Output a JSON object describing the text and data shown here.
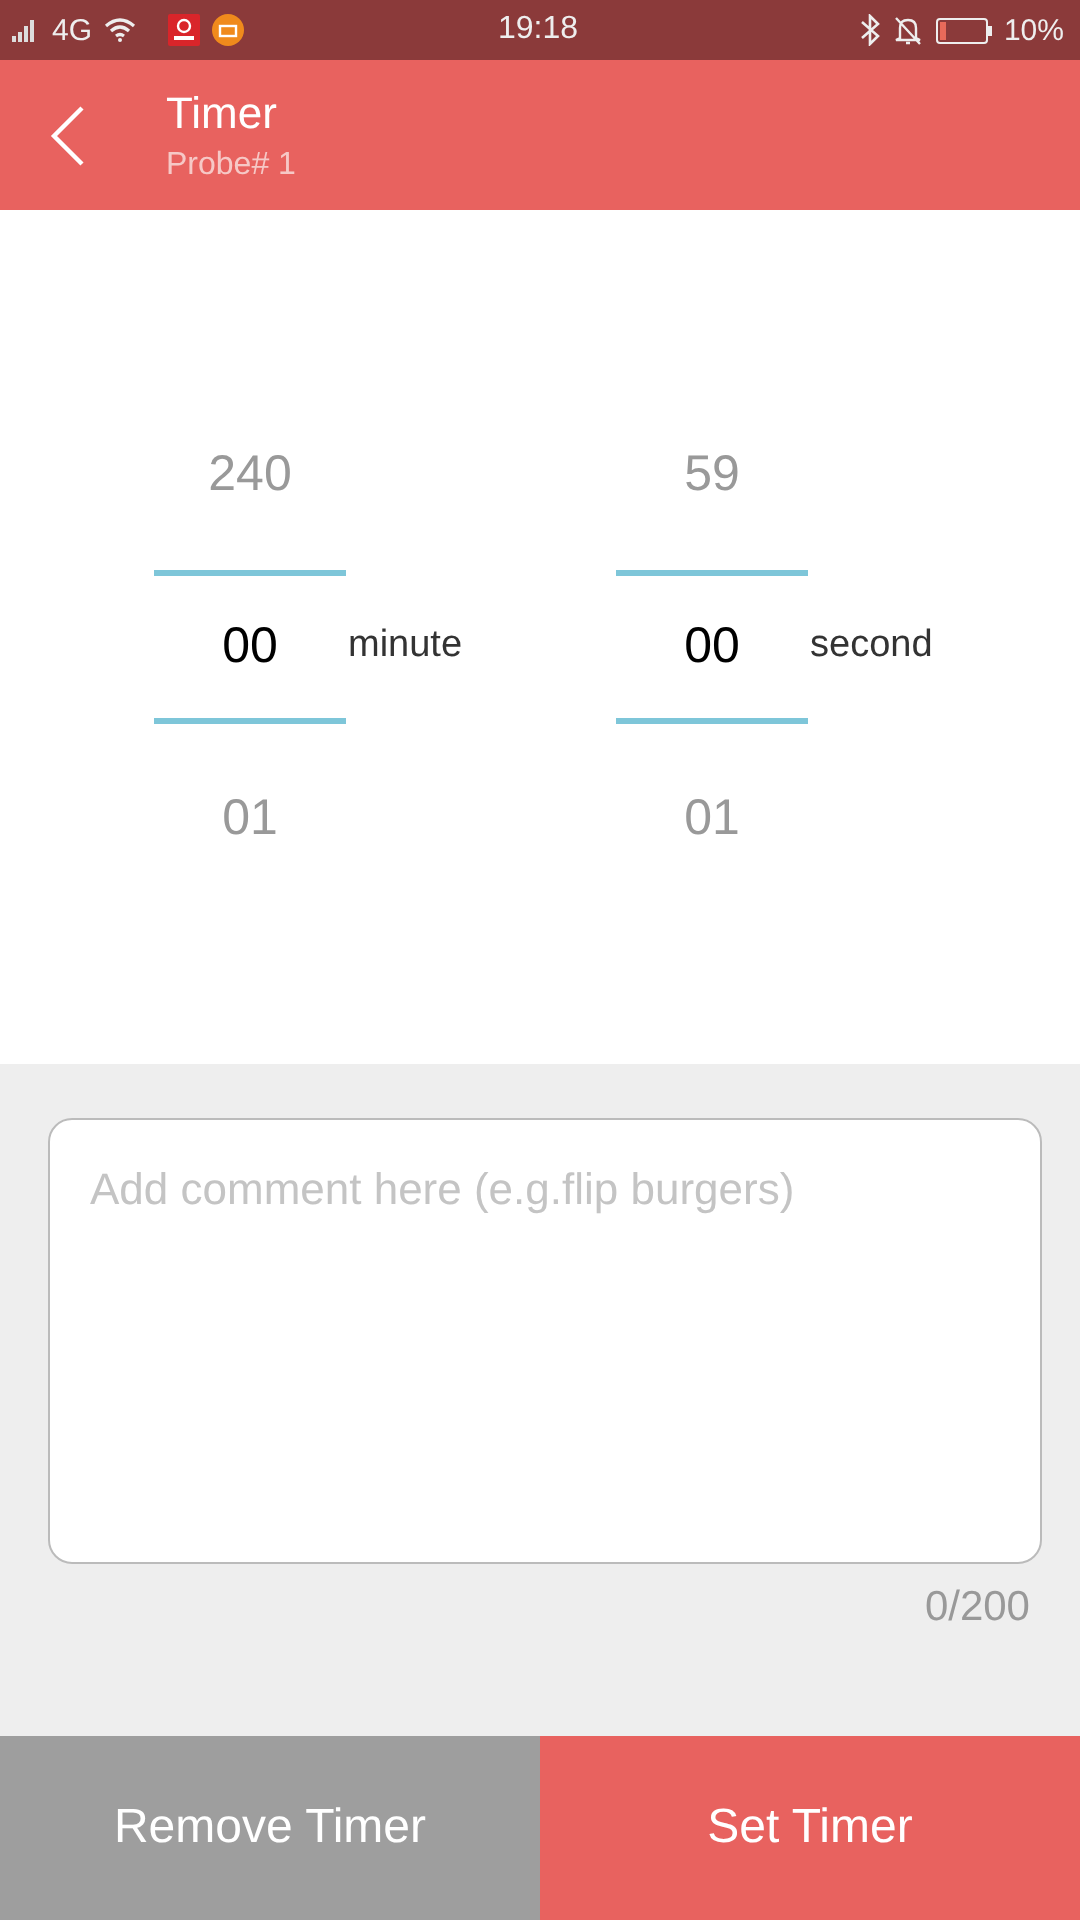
{
  "status_bar": {
    "network": "4G",
    "time": "19:18",
    "battery": "10%"
  },
  "header": {
    "title": "Timer",
    "subtitle": "Probe# 1"
  },
  "pickers": [
    {
      "unit": "minute",
      "values": [
        {
          "text": "240",
          "selected": false
        },
        {
          "text": "00",
          "selected": true
        },
        {
          "text": "01",
          "selected": false
        }
      ]
    },
    {
      "unit": "second",
      "values": [
        {
          "text": "59",
          "selected": false
        },
        {
          "text": "00",
          "selected": true
        },
        {
          "text": "01",
          "selected": false
        }
      ]
    }
  ],
  "comment": {
    "placeholder": "Add comment here (e.g.flip burgers)",
    "counter": "0/200"
  },
  "buttons": [
    {
      "label": "Remove Timer",
      "kind": "secondary"
    },
    {
      "label": "Set Timer",
      "kind": "primary"
    }
  ]
}
